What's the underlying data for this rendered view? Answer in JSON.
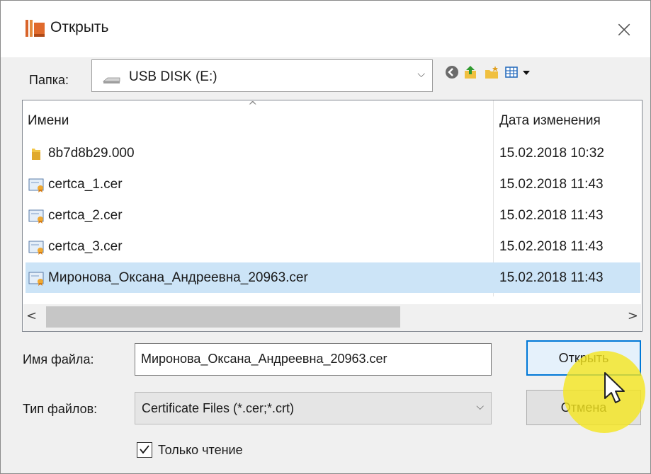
{
  "window": {
    "title": "Открыть",
    "close_symbol": "×"
  },
  "toolbar": {
    "folder_label": "Папка:",
    "folder_value": "USB DISK (E:)",
    "folder_dropdown_symbol": "⌵",
    "icons": [
      "back-icon",
      "up-folder-icon",
      "new-folder-icon",
      "view-menu-icon"
    ]
  },
  "file_list": {
    "columns": {
      "name": "Имени",
      "date": "Дата изменения",
      "sort_indicator": "^"
    },
    "rows": [
      {
        "name": "8b7d8b29.000",
        "date": "15.02.2018 10:32",
        "icon": "folder-icon",
        "selected": false
      },
      {
        "name": "certca_1.cer",
        "date": "15.02.2018 11:43",
        "icon": "certificate-icon",
        "selected": false
      },
      {
        "name": "certca_2.cer",
        "date": "15.02.2018 11:43",
        "icon": "certificate-icon",
        "selected": false
      },
      {
        "name": "certca_3.cer",
        "date": "15.02.2018 11:43",
        "icon": "certificate-icon",
        "selected": false
      },
      {
        "name": "Миронова_Оксана_Андреевна_20963.cer",
        "date": "15.02.2018 11:43",
        "icon": "certificate-icon",
        "selected": true
      }
    ],
    "scroll_left": "<",
    "scroll_right": ">"
  },
  "form": {
    "filename_label": "Имя файла:",
    "filename_value": "Миронова_Оксана_Андреевна_20963.cer",
    "filetype_label": "Тип файлов:",
    "filetype_value": "Certificate Files (*.cer;*.crt)",
    "filetype_dropdown_symbol": "⌵",
    "readonly_label": "Только чтение",
    "readonly_checked": true
  },
  "buttons": {
    "open": "Открыть",
    "cancel": "Отмена"
  },
  "colors": {
    "selection": "#cce4f7",
    "accent": "#0078d7",
    "cursor_highlight": "#f5e61e"
  }
}
